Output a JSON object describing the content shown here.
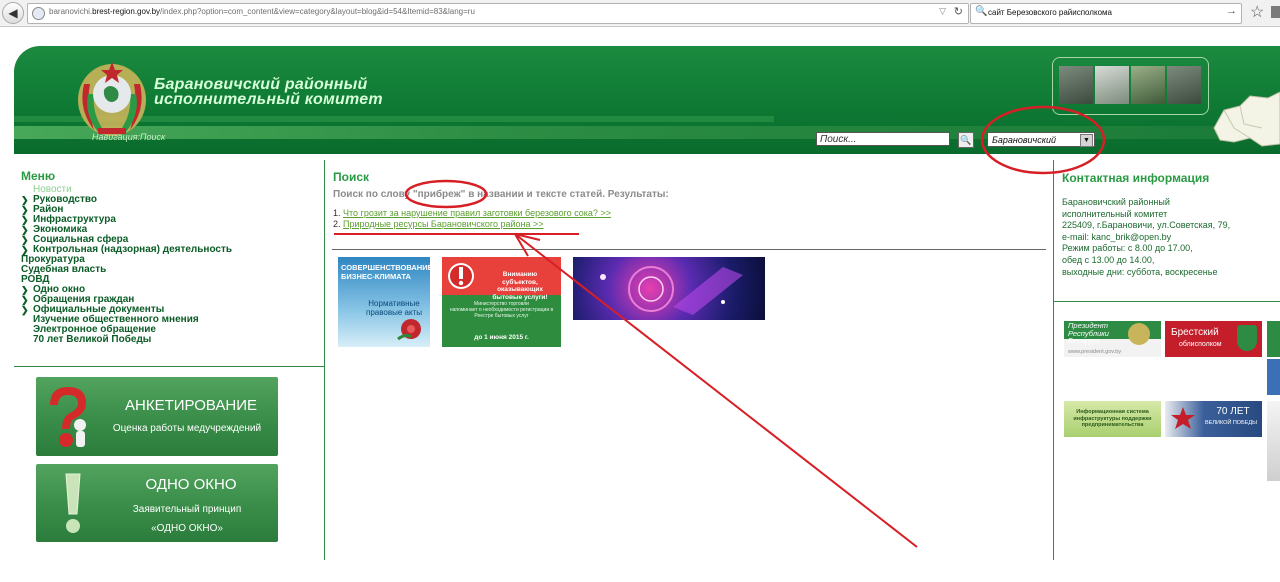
{
  "browser": {
    "url_prefix": "baranovichi.",
    "url_host": "brest-region.gov.by",
    "url_path": "/index.php?option=com_content&view=category&layout=blog&id=54&Itemid=83&lang=ru",
    "search_query": "сайт Березовского райисполкома"
  },
  "header": {
    "title_line1": "Барановичский районный",
    "title_line2": "исполнительный комитет",
    "nav_label": "Навигация:",
    "nav_current": "Поиск",
    "search_placeholder": "Поиск...",
    "region_selected": "Барановичский"
  },
  "menu": {
    "title": "Меню",
    "items": [
      {
        "label": "Новости",
        "arrow": false,
        "light": true
      },
      {
        "label": "Руководство",
        "arrow": true,
        "light": false
      },
      {
        "label": "Район",
        "arrow": true,
        "light": false
      },
      {
        "label": "Инфраструктура",
        "arrow": true,
        "light": false
      },
      {
        "label": "Экономика",
        "arrow": true,
        "light": false
      },
      {
        "label": "Социальная сфера",
        "arrow": true,
        "light": false
      },
      {
        "label": "Контрольная (надзорная) деятельность",
        "arrow": true,
        "light": false
      },
      {
        "label": "Прокуратура",
        "arrow": false,
        "light": false
      },
      {
        "label": "Судебная власть",
        "arrow": false,
        "light": false
      },
      {
        "label": "РОВД",
        "arrow": false,
        "light": false
      },
      {
        "label": "Одно окно",
        "arrow": true,
        "light": false
      },
      {
        "label": "Обращения граждан",
        "arrow": true,
        "light": false
      },
      {
        "label": "Официальные документы",
        "arrow": true,
        "light": false
      },
      {
        "label": "Изучение общественного мнения",
        "arrow": false,
        "light": false
      },
      {
        "label": "Электронное обращение",
        "arrow": false,
        "light": false
      },
      {
        "label": "70 лет Великой Победы",
        "arrow": false,
        "light": false
      }
    ]
  },
  "banners": {
    "anket_title": "АНКЕТИРОВАНИЕ",
    "anket_sub": "Оценка работы медучреждений",
    "okno_title": "ОДНО ОКНО",
    "okno_sub1": "Заявительный принцип",
    "okno_sub2": "«ОДНО ОКНО»"
  },
  "search": {
    "title": "Поиск",
    "summary_before": "Поиск по слову ",
    "summary_word": "\"прибреж\"",
    "summary_after": " в названии и тексте статей. Результаты:",
    "results": [
      {
        "num": "1.",
        "title": "Что грозит за нарушение правил заготовки березового сока? >>"
      },
      {
        "num": "2.",
        "title": "Природные ресурсы Барановичского района >>"
      }
    ]
  },
  "center_ads": {
    "biz_line1": "СОВЕРШЕНСТВОВАНИЕ",
    "biz_line2": "БИЗНЕС-КЛИМАТА",
    "biz_line3": "Нормативные",
    "biz_line4": "правовые акты",
    "warn_line1": "Вниманию",
    "warn_line2": "субъектов, оказывающих",
    "warn_line3": "бытовые услуги!",
    "warn_line4": "Министерство торговли",
    "warn_line5": "напоминает о необходимости регистрации в",
    "warn_line6": "Реестре бытовых услуг",
    "warn_date": "до 1 июня 2015 г."
  },
  "contact": {
    "title": "Контактная информация",
    "lines": [
      "Барановичский районный",
      "исполнительный комитет",
      "225409, г.Барановичи, ул.Советская, 79,",
      "e-mail: kanc_brik@open.by",
      "Режим работы: с 8.00 до 17.00,",
      "обед с 13.00 до 14.00,",
      "выходные дни: суббота, воскресенье"
    ]
  },
  "right_banners": {
    "president_line1": "Президент",
    "president_line2": "Республики",
    "president_line3": "Беларусь",
    "president_url": "www.president.gov.by",
    "brest_line1": "Брестский",
    "brest_line2": "облисполком",
    "info_line1": "Информационная система",
    "info_line2": "инфраструктуры поддержки",
    "info_line3": "предпринимательства",
    "victory_line1": "70 ЛЕТ",
    "victory_line2": "ВЕЛИКОЙ ПОБЕДЫ"
  },
  "colors": {
    "header_green": "#0e7a34",
    "accent_green": "#2a9a44",
    "link_green": "#5a9e2e",
    "annotation_red": "#d71f26"
  }
}
